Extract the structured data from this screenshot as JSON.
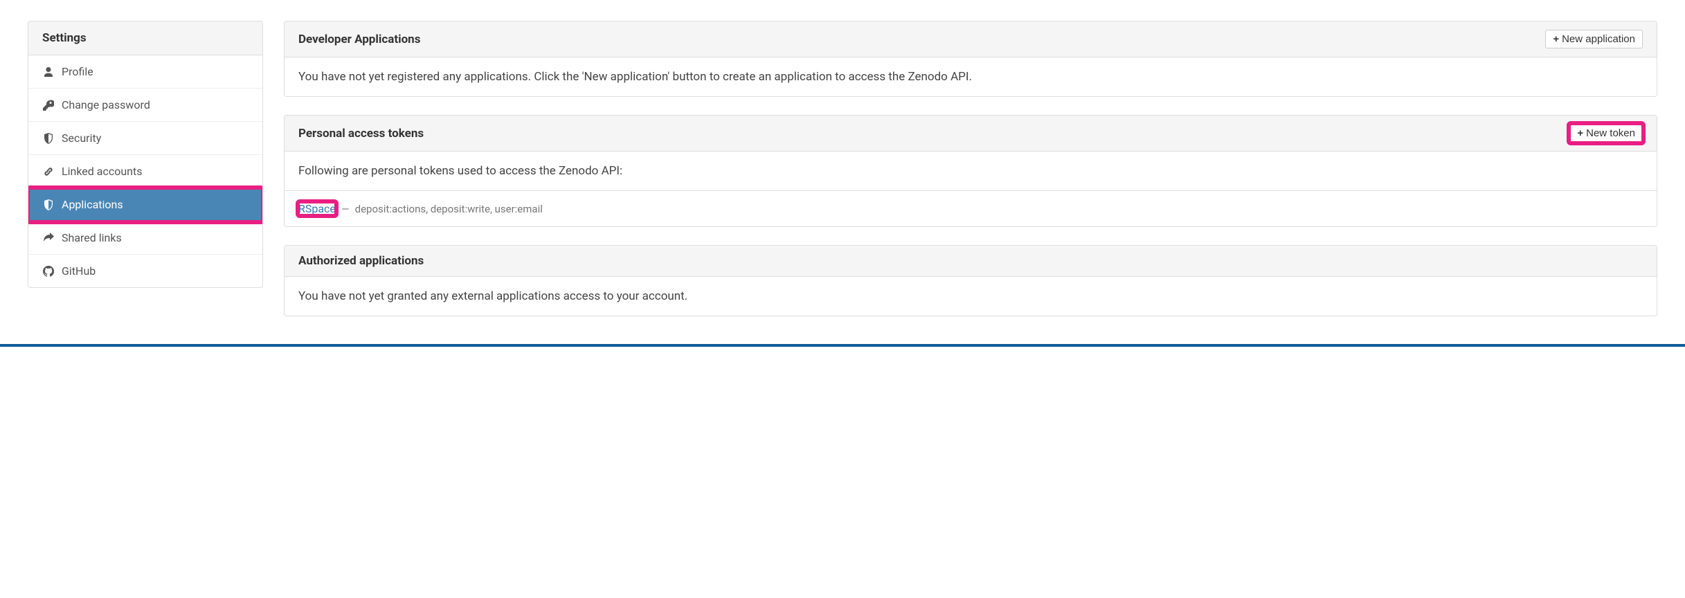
{
  "sidebar": {
    "title": "Settings",
    "items": [
      {
        "label": "Profile"
      },
      {
        "label": "Change password"
      },
      {
        "label": "Security"
      },
      {
        "label": "Linked accounts"
      },
      {
        "label": "Applications"
      },
      {
        "label": "Shared links"
      },
      {
        "label": "GitHub"
      }
    ]
  },
  "panels": {
    "developer": {
      "title": "Developer Applications",
      "button": "New application",
      "body": "You have not yet registered any applications. Click the 'New application' button to create an application to access the Zenodo API."
    },
    "tokens": {
      "title": "Personal access tokens",
      "button": "New token",
      "body": "Following are personal tokens used to access the Zenodo API:",
      "list": [
        {
          "name": "RSpace",
          "scopes": "deposit:actions, deposit:write, user:email"
        }
      ]
    },
    "authorized": {
      "title": "Authorized applications",
      "body": "You have not yet granted any external applications access to your account."
    }
  }
}
